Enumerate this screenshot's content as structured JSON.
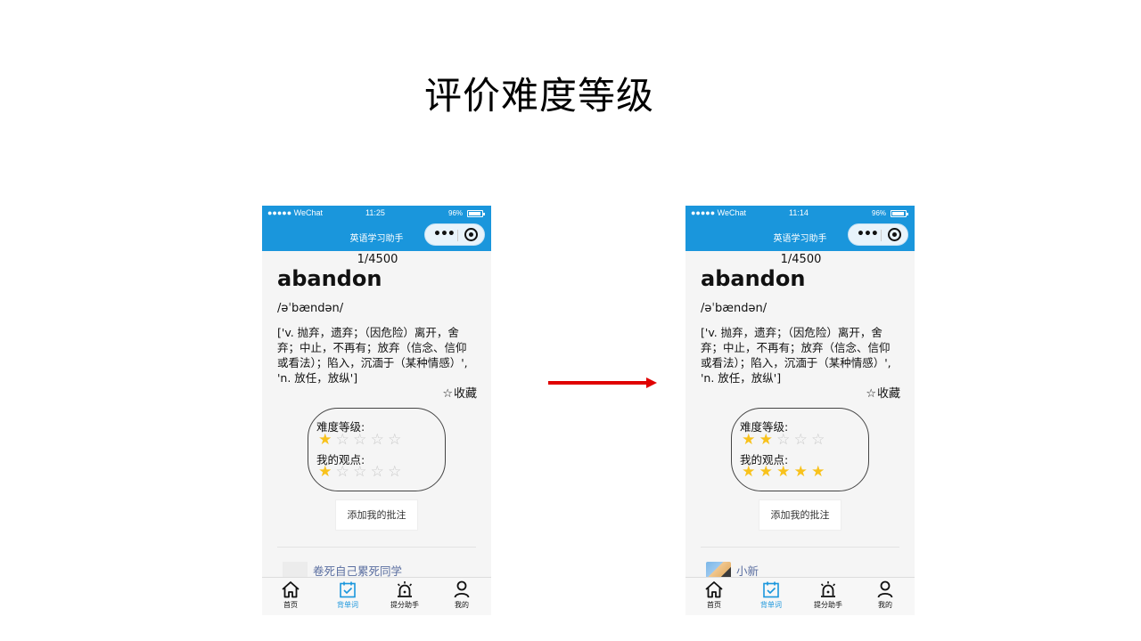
{
  "slide": {
    "title": "评价难度等级"
  },
  "phones": [
    {
      "status": {
        "carrier": "●●●●● WeChat",
        "time": "11:25",
        "battery": "96%"
      },
      "nav_title": "英语学习助手",
      "counter": "1/4500",
      "word": "abandon",
      "phonetic": "/əˈbændən/",
      "definition": "['v. 抛弃，遗弃；（因危险）离开，舍弃；中止，不再有；放弃（信念、信仰或看法）；陷入，沉湎于（某种情感）', 'n. 放任，放纵']",
      "favorite_label": "收藏",
      "difficulty_label": "难度等级:",
      "difficulty_rating": 1,
      "opinion_label": "我的观点:",
      "opinion_rating": 1,
      "annotate_label": "添加我的批注",
      "comment_name": "卷死自己累死同学",
      "tabs": [
        "首页",
        "背单词",
        "提分助手",
        "我的"
      ]
    },
    {
      "status": {
        "carrier": "●●●●● WeChat",
        "time": "11:14",
        "battery": "96%"
      },
      "nav_title": "英语学习助手",
      "counter": "1/4500",
      "word": "abandon",
      "phonetic": "/əˈbændən/",
      "definition": "['v. 抛弃，遗弃；（因危险）离开，舍弃；中止，不再有；放弃（信念、信仰或看法）；陷入，沉湎于（某种情感）', 'n. 放任，放纵']",
      "favorite_label": "收藏",
      "difficulty_label": "难度等级:",
      "difficulty_rating": 2,
      "opinion_label": "我的观点:",
      "opinion_rating": 5,
      "annotate_label": "添加我的批注",
      "comment_name": "小新",
      "tabs": [
        "首页",
        "背单词",
        "提分助手",
        "我的"
      ]
    }
  ],
  "colors": {
    "accent": "#1a96dc",
    "star_filled": "#f8c21c",
    "star_empty": "#c8c8c8",
    "arrow": "#e00000"
  },
  "max_stars": 5
}
